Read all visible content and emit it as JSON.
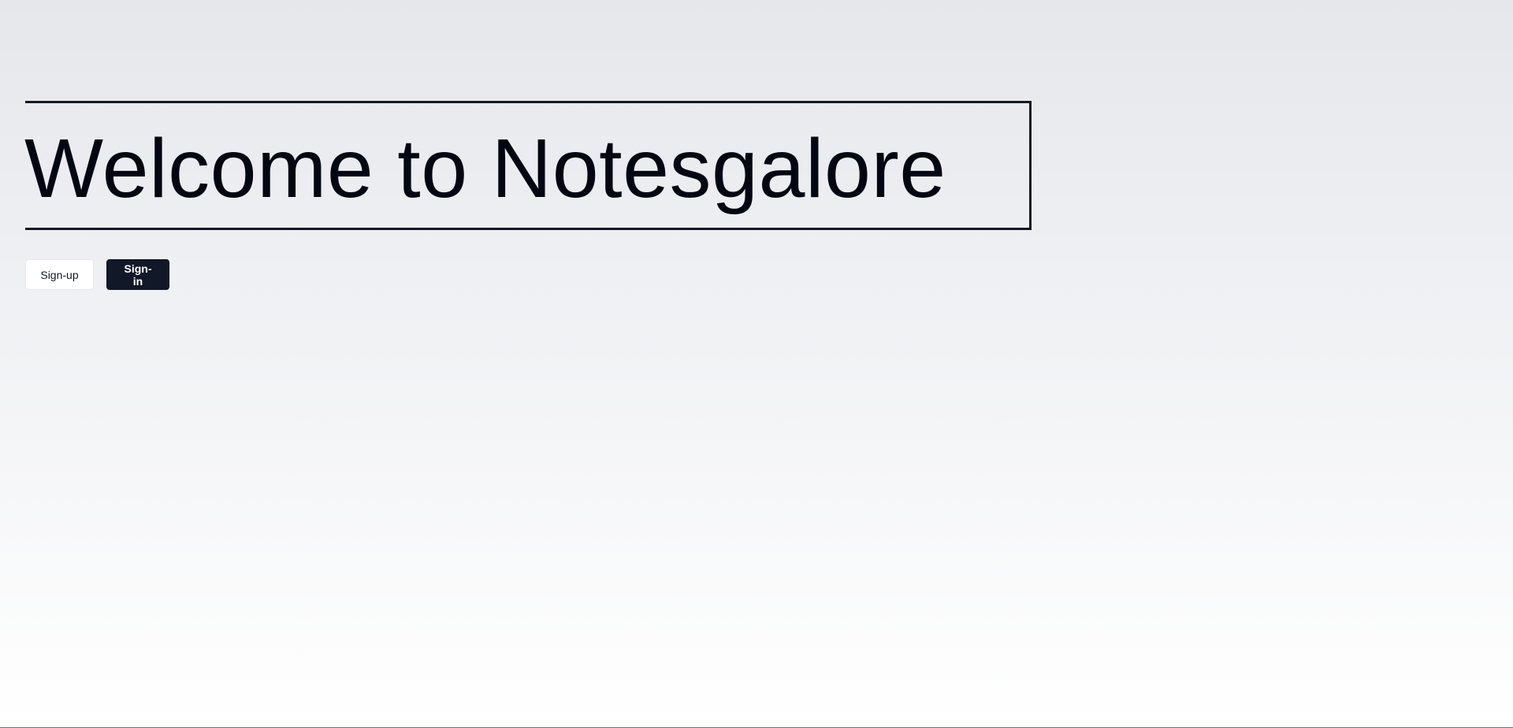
{
  "hero": {
    "title": "Welcome to Notesgalore"
  },
  "actions": {
    "signup_label": "Sign-up",
    "signin_label": "Sign-in"
  },
  "colors": {
    "primary": "#111827",
    "background_top": "#e5e7eb",
    "background_bottom": "#ffffff"
  }
}
